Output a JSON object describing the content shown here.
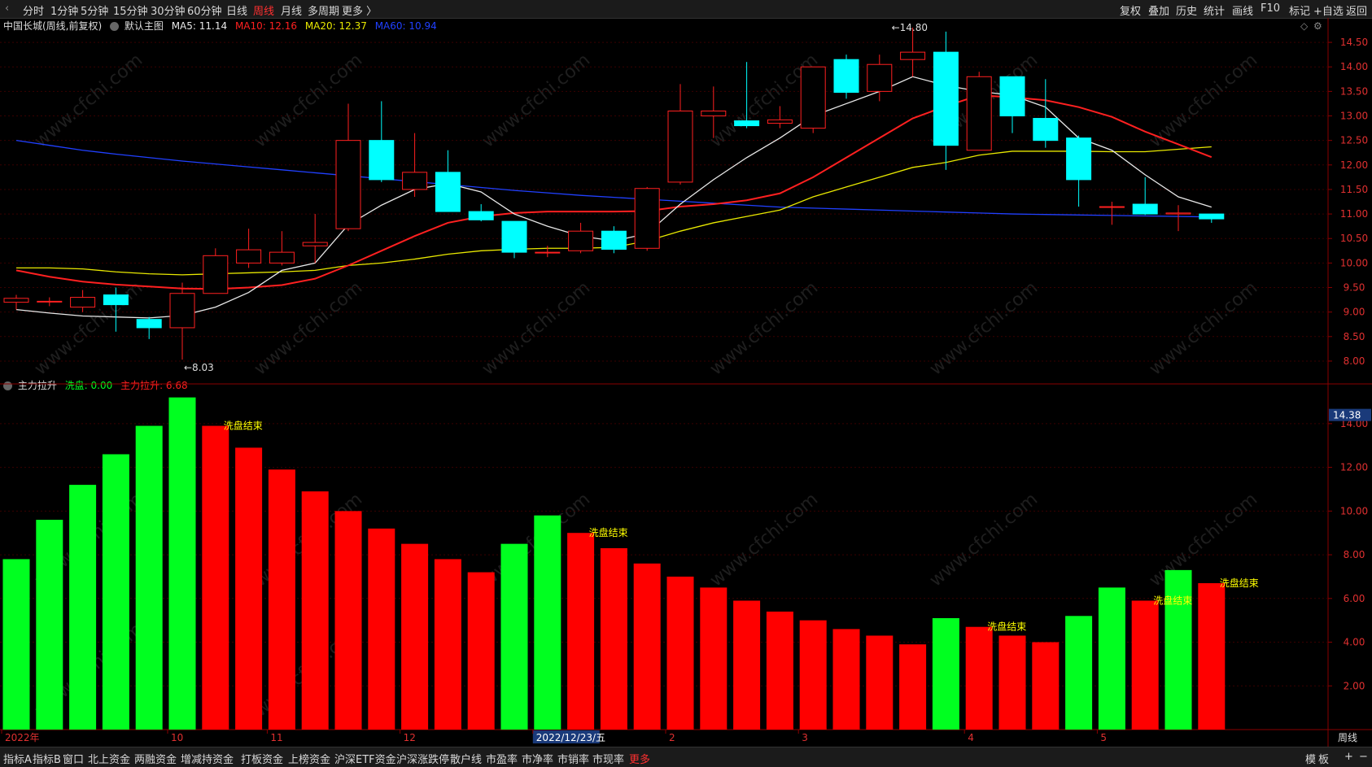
{
  "toolbar_left": [
    {
      "label": "分时",
      "active": false
    },
    {
      "label": "1分钟",
      "active": false
    },
    {
      "label": "5分钟",
      "active": false
    },
    {
      "label": "15分钟",
      "active": false
    },
    {
      "label": "30分钟",
      "active": false
    },
    {
      "label": "60分钟",
      "active": false
    },
    {
      "label": "日线",
      "active": false
    },
    {
      "label": "周线",
      "active": true
    },
    {
      "label": "月线",
      "active": false
    },
    {
      "label": "多周期",
      "active": false
    },
    {
      "label": "更多 〉",
      "active": false
    }
  ],
  "toolbar_right": [
    "复权",
    "叠加",
    "历史",
    "统计",
    "画线",
    "F10",
    "标记",
    "+自选",
    "返回"
  ],
  "price_legend": {
    "stock": "中国长城(周线,前复权)",
    "main": "默认主图",
    "ma5": "MA5: 11.14",
    "ma10": "MA10: 12.16",
    "ma20": "MA20: 12.37",
    "ma60": "MA60: 10.94"
  },
  "indicator_legend": {
    "name": "主力拉升",
    "wash": "洗盘: 0.00",
    "pull": "主力拉升: 6.68"
  },
  "price_axis": [
    "14.50",
    "14.00",
    "13.50",
    "13.00",
    "12.50",
    "12.00",
    "11.50",
    "11.00",
    "10.50",
    "10.00",
    "9.50",
    "9.00",
    "8.50",
    "8.00"
  ],
  "indicator_axis": [
    "14.00",
    "12.00",
    "10.00",
    "8.00",
    "6.00",
    "4.00",
    "2.00"
  ],
  "indicator_current": "14.38",
  "x_labels": [
    "2022年",
    "10",
    "11",
    "12",
    "2022/12/23/五",
    "2",
    "3",
    "4",
    "5"
  ],
  "axis_mode": "周线",
  "max_label": "14.80",
  "min_label": "8.03",
  "watermark": "www.cfchi.com",
  "colors": {
    "up": "#ff2020",
    "down": "#00ffff",
    "ma5": "#e8e8e8",
    "ma10": "#ff2020",
    "ma20": "#e8e800",
    "ma60": "#2040ff",
    "green_bar": "#00ff20",
    "red_bar": "#ff0000",
    "signal": "#ffff00"
  },
  "chart_data": {
    "type": "candlestick",
    "ylim": [
      7.8,
      14.8
    ],
    "candles": [
      {
        "o": 9.2,
        "h": 9.35,
        "l": 9.05,
        "c": 9.28
      },
      {
        "o": 9.22,
        "h": 9.3,
        "l": 9.12,
        "c": 9.22
      },
      {
        "o": 9.1,
        "h": 9.45,
        "l": 9.0,
        "c": 9.3
      },
      {
        "o": 9.35,
        "h": 9.5,
        "l": 8.6,
        "c": 9.15
      },
      {
        "o": 8.85,
        "h": 8.9,
        "l": 8.45,
        "c": 8.68
      },
      {
        "o": 8.68,
        "h": 9.6,
        "l": 8.03,
        "c": 9.38
      },
      {
        "o": 9.38,
        "h": 10.3,
        "l": 9.38,
        "c": 10.15
      },
      {
        "o": 10.0,
        "h": 10.7,
        "l": 9.9,
        "c": 10.27
      },
      {
        "o": 10.0,
        "h": 10.65,
        "l": 9.95,
        "c": 10.22
      },
      {
        "o": 10.35,
        "h": 11.0,
        "l": 10.0,
        "c": 10.42
      },
      {
        "o": 10.7,
        "h": 13.25,
        "l": 10.65,
        "c": 12.5
      },
      {
        "o": 12.5,
        "h": 13.3,
        "l": 11.65,
        "c": 11.7
      },
      {
        "o": 11.5,
        "h": 12.65,
        "l": 11.35,
        "c": 11.85
      },
      {
        "o": 11.85,
        "h": 12.3,
        "l": 11.05,
        "c": 11.05
      },
      {
        "o": 11.05,
        "h": 11.2,
        "l": 10.85,
        "c": 10.88
      },
      {
        "o": 10.85,
        "h": 10.85,
        "l": 10.1,
        "c": 10.22
      },
      {
        "o": 10.22,
        "h": 10.35,
        "l": 10.12,
        "c": 10.22
      },
      {
        "o": 10.25,
        "h": 10.82,
        "l": 10.2,
        "c": 10.65
      },
      {
        "o": 10.65,
        "h": 10.75,
        "l": 10.2,
        "c": 10.28
      },
      {
        "o": 10.3,
        "h": 11.55,
        "l": 10.25,
        "c": 11.52
      },
      {
        "o": 11.65,
        "h": 13.65,
        "l": 11.6,
        "c": 13.1
      },
      {
        "o": 13.0,
        "h": 13.6,
        "l": 12.55,
        "c": 13.1
      },
      {
        "o": 12.9,
        "h": 14.1,
        "l": 12.75,
        "c": 12.8
      },
      {
        "o": 12.85,
        "h": 13.2,
        "l": 12.75,
        "c": 12.92
      },
      {
        "o": 12.75,
        "h": 13.95,
        "l": 12.65,
        "c": 14.0
      },
      {
        "o": 14.15,
        "h": 14.25,
        "l": 13.35,
        "c": 13.48
      },
      {
        "o": 13.5,
        "h": 14.25,
        "l": 13.3,
        "c": 14.05
      },
      {
        "o": 14.15,
        "h": 14.8,
        "l": 13.8,
        "c": 14.3
      },
      {
        "o": 14.3,
        "h": 14.72,
        "l": 11.9,
        "c": 12.4
      },
      {
        "o": 12.3,
        "h": 13.9,
        "l": 12.3,
        "c": 13.8
      },
      {
        "o": 13.8,
        "h": 13.8,
        "l": 12.65,
        "c": 13.0
      },
      {
        "o": 12.95,
        "h": 13.75,
        "l": 12.35,
        "c": 12.5
      },
      {
        "o": 12.55,
        "h": 12.6,
        "l": 11.15,
        "c": 11.7
      },
      {
        "o": 11.15,
        "h": 11.25,
        "l": 10.78,
        "c": 11.15
      },
      {
        "o": 11.2,
        "h": 11.75,
        "l": 10.98,
        "c": 11.0
      },
      {
        "o": 11.0,
        "h": 11.18,
        "l": 10.65,
        "c": 11.02
      },
      {
        "o": 11.0,
        "h": 11.0,
        "l": 10.82,
        "c": 10.9
      }
    ],
    "ma5": [
      9.05,
      8.98,
      8.92,
      8.9,
      8.88,
      8.93,
      9.1,
      9.4,
      9.85,
      10.0,
      10.78,
      11.18,
      11.5,
      11.62,
      11.45,
      11.0,
      10.75,
      10.55,
      10.45,
      10.6,
      11.2,
      11.7,
      12.15,
      12.55,
      13.0,
      13.25,
      13.5,
      13.8,
      13.62,
      13.5,
      13.42,
      13.18,
      12.55,
      12.3,
      11.8,
      11.35,
      11.14
    ],
    "ma10": [
      9.85,
      9.72,
      9.62,
      9.56,
      9.52,
      9.48,
      9.47,
      9.5,
      9.55,
      9.68,
      9.95,
      10.25,
      10.55,
      10.82,
      10.95,
      11.02,
      11.05,
      11.05,
      11.05,
      11.06,
      11.15,
      11.2,
      11.28,
      11.42,
      11.75,
      12.15,
      12.55,
      12.95,
      13.2,
      13.42,
      13.38,
      13.32,
      13.18,
      12.98,
      12.68,
      12.42,
      12.16
    ],
    "ma20": [
      9.9,
      9.9,
      9.88,
      9.82,
      9.78,
      9.76,
      9.78,
      9.8,
      9.82,
      9.85,
      9.95,
      10.0,
      10.08,
      10.18,
      10.25,
      10.28,
      10.3,
      10.3,
      10.32,
      10.45,
      10.65,
      10.82,
      10.95,
      11.08,
      11.35,
      11.55,
      11.75,
      11.95,
      12.05,
      12.2,
      12.28,
      12.28,
      12.28,
      12.27,
      12.27,
      12.32,
      12.37
    ],
    "ma60": [
      12.5,
      12.4,
      12.3,
      12.22,
      12.15,
      12.08,
      12.02,
      11.96,
      11.9,
      11.84,
      11.78,
      11.72,
      11.66,
      11.6,
      11.54,
      11.48,
      11.43,
      11.38,
      11.34,
      11.3,
      11.26,
      11.22,
      11.18,
      11.14,
      11.12,
      11.1,
      11.08,
      11.06,
      11.04,
      11.02,
      11.0,
      10.99,
      10.98,
      10.97,
      10.96,
      10.95,
      10.94
    ],
    "indicator": {
      "ylim": [
        0,
        15
      ],
      "values": [
        7.8,
        9.6,
        11.2,
        12.6,
        13.9,
        15.2,
        13.9,
        12.9,
        11.9,
        10.9,
        10.0,
        9.2,
        8.5,
        7.8,
        7.2,
        8.5,
        9.8,
        9.0,
        8.3,
        7.6,
        7.0,
        6.5,
        5.9,
        5.4,
        5.0,
        4.6,
        4.3,
        3.9,
        5.1,
        4.7,
        4.3,
        4.0,
        5.2,
        6.5,
        5.9,
        7.3,
        6.7
      ],
      "colors": [
        "g",
        "g",
        "g",
        "g",
        "g",
        "g",
        "r",
        "r",
        "r",
        "r",
        "r",
        "r",
        "r",
        "r",
        "r",
        "g",
        "g",
        "r",
        "r",
        "r",
        "r",
        "r",
        "r",
        "r",
        "r",
        "r",
        "r",
        "r",
        "g",
        "r",
        "r",
        "r",
        "g",
        "g",
        "r",
        "g",
        "r"
      ],
      "signals": [
        {
          "index": 6,
          "label": "洗盘结束"
        },
        {
          "index": 17,
          "label": "洗盘结束"
        },
        {
          "index": 29,
          "label": "洗盘结束"
        },
        {
          "index": 34,
          "label": "洗盘结束"
        },
        {
          "index": 36,
          "label": "洗盘结束"
        }
      ]
    }
  },
  "bottom_tabs": [
    {
      "label": "指标A",
      "active": false
    },
    {
      "label": "指标B",
      "active": false
    },
    {
      "label": "窗口",
      "active": false
    },
    {
      "label": "北上资金",
      "active": false
    },
    {
      "label": "两融资金",
      "active": false
    },
    {
      "label": "增减持资金",
      "active": false
    },
    {
      "label": "打板资金",
      "active": false
    },
    {
      "label": "上榜资金",
      "active": false
    },
    {
      "label": "沪深ETF资金",
      "active": false
    },
    {
      "label": "沪深涨跌停",
      "active": false
    },
    {
      "label": "散户线",
      "active": false
    },
    {
      "label": "市盈率",
      "active": false
    },
    {
      "label": "市净率",
      "active": false
    },
    {
      "label": "市销率",
      "active": false
    },
    {
      "label": "市现率",
      "active": false
    },
    {
      "label": "更多",
      "active": true
    }
  ],
  "bottom_right": [
    "模",
    "板",
    "+",
    "−"
  ]
}
